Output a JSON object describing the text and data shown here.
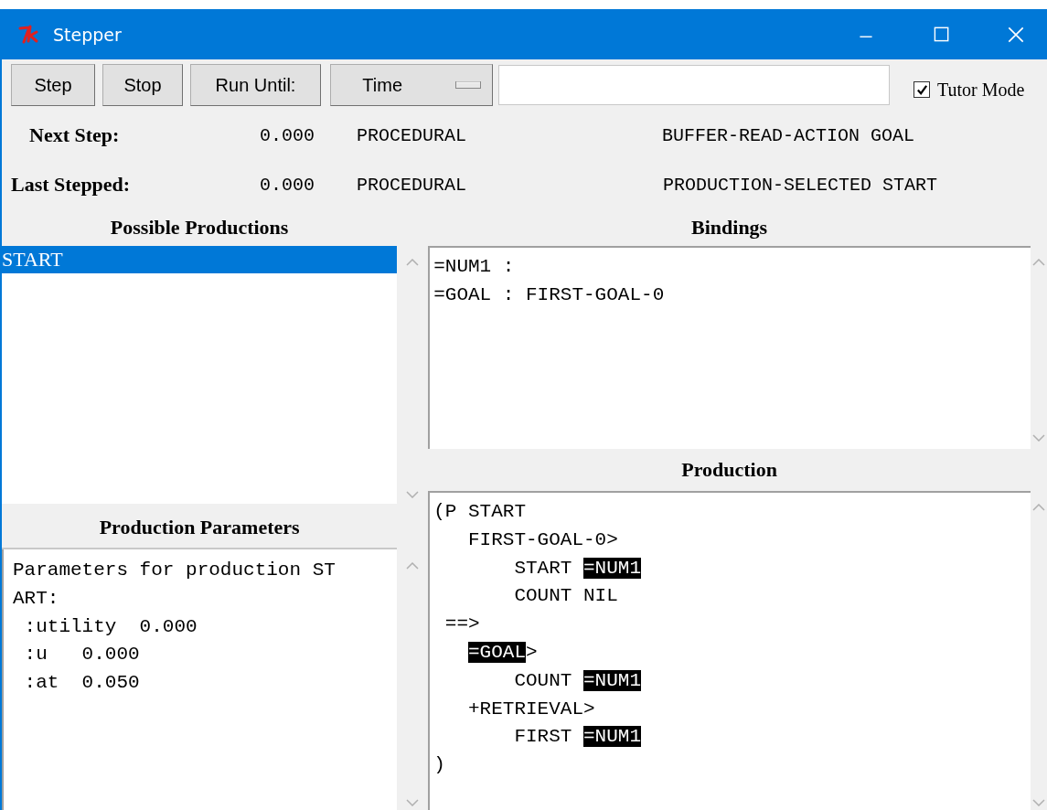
{
  "window": {
    "title": "Stepper"
  },
  "toolbar": {
    "buttons": [
      "Step",
      "Stop",
      "Run Until:"
    ],
    "run_until_menu": {
      "value": "Time"
    },
    "tutor_mode": {
      "label": "Tutor Mode",
      "checked": true
    }
  },
  "status": [
    {
      "label": "Next Step:",
      "time": "0.000",
      "module": "PROCEDURAL",
      "event": "BUFFER-READ-ACTION GOAL"
    },
    {
      "label": "Last Stepped:",
      "time": "0.000",
      "module": "PROCEDURAL",
      "event": "PRODUCTION-SELECTED START"
    }
  ],
  "possible_productions": {
    "title": "Possible Productions",
    "items": [
      {
        "label": "START",
        "selected": true
      }
    ]
  },
  "production_parameters": {
    "title": "Production Parameters",
    "lines": [
      "Parameters for production ST",
      "ART:",
      " :utility  0.000",
      " :u   0.000",
      " :at  0.050"
    ]
  },
  "bindings": {
    "title": "Bindings",
    "lines": [
      "=NUM1 :",
      "=GOAL : FIRST-GOAL-0"
    ]
  },
  "production": {
    "title": "Production",
    "lines": [
      "(P START",
      "   FIRST-GOAL-0>",
      "       START **=NUM1**",
      "       COUNT NIL",
      " ==>",
      "   **=GOAL**>",
      "       COUNT **=NUM1**",
      "   +RETRIEVAL>",
      "       FIRST **=NUM1**",
      ")"
    ]
  }
}
